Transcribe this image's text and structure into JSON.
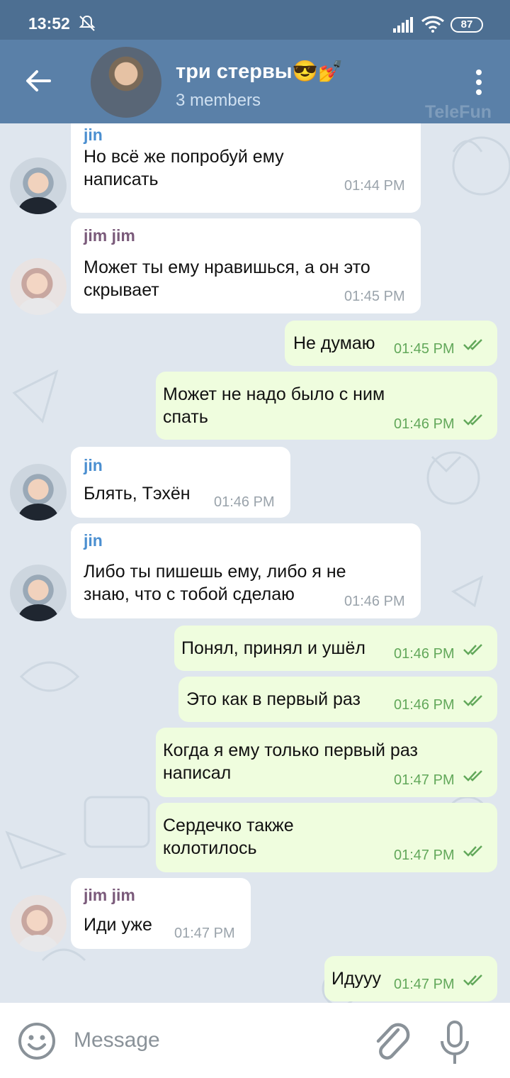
{
  "status_bar": {
    "time": "13:52",
    "battery": "87",
    "icons": [
      "mute-bell-icon",
      "signal-icon",
      "wifi-icon",
      "battery-icon"
    ]
  },
  "header": {
    "title": "три стервы😎💅",
    "subtitle": "3 members",
    "watermark": "TeleFun",
    "icons": [
      "back-arrow-icon",
      "more-vert-icon"
    ]
  },
  "messages": [
    {
      "direction": "in",
      "sender": "jin",
      "lines": [
        "Но всё же попробуй ему",
        "написать"
      ],
      "time": "01:44 PM"
    },
    {
      "direction": "in",
      "sender": "jim jim",
      "lines": [
        "Может ты ему нравишься, а он это",
        "скрывает"
      ],
      "time": "01:45 PM"
    },
    {
      "direction": "out",
      "lines": [
        "Не думаю"
      ],
      "time": "01:45 PM",
      "read": true
    },
    {
      "direction": "out",
      "lines": [
        "Может не надо было с ним",
        "спать"
      ],
      "time": "01:46 PM",
      "read": true
    },
    {
      "direction": "in",
      "sender": "jin",
      "lines": [
        "Блять, Тэхён"
      ],
      "time": "01:46 PM"
    },
    {
      "direction": "in",
      "sender": "jin",
      "lines": [
        "Либо ты пишешь ему, либо я не",
        "знаю, что с тобой сделаю"
      ],
      "time": "01:46 PM"
    },
    {
      "direction": "out",
      "lines": [
        "Понял, принял и ушёл"
      ],
      "time": "01:46 PM",
      "read": true
    },
    {
      "direction": "out",
      "lines": [
        "Это как в первый раз"
      ],
      "time": "01:46 PM",
      "read": true
    },
    {
      "direction": "out",
      "lines": [
        "Когда я ему только первый раз",
        "написал"
      ],
      "time": "01:47 PM",
      "read": true
    },
    {
      "direction": "out",
      "lines": [
        "Сердечко также",
        "колотилось"
      ],
      "time": "01:47 PM",
      "read": true
    },
    {
      "direction": "in",
      "sender": "jim jim",
      "lines": [
        "Иди уже"
      ],
      "time": "01:47 PM"
    },
    {
      "direction": "out",
      "lines": [
        "Идууу"
      ],
      "time": "01:47 PM",
      "read": true
    }
  ],
  "composer": {
    "placeholder": "Message",
    "icons": [
      "emoji-icon",
      "attach-icon",
      "mic-icon"
    ]
  },
  "colors": {
    "header": "#5a80a8",
    "status_bar": "#4d6f92",
    "incoming_bubble": "#ffffff",
    "outgoing_bubble": "#effdde",
    "read_check": "#62a85a",
    "sender_jin": "#4b8fd0",
    "sender_jimjim": "#7a5a7a"
  }
}
